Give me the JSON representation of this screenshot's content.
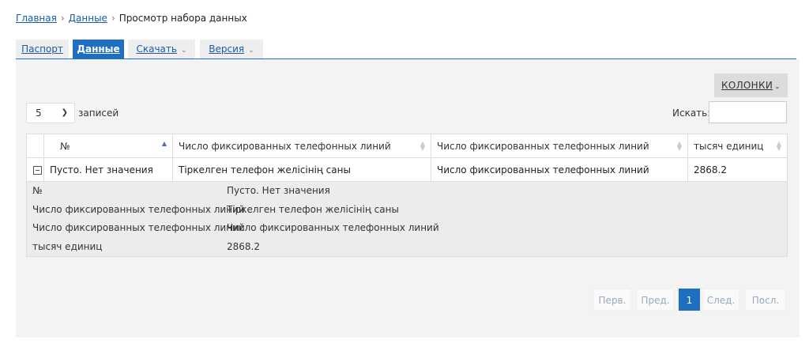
{
  "breadcrumb": {
    "home": "Главная",
    "data": "Данные",
    "current": "Просмотр набора данных",
    "separator": "›"
  },
  "tabs": {
    "passport": "Паспорт",
    "data": "Данные",
    "download": "Скачать",
    "version": "Версия",
    "caret": "⌄"
  },
  "toolbar": {
    "columns_label": "КОЛОНКИ",
    "length_value": "5",
    "length_suffix": "записей",
    "search_label": "Искать:",
    "search_value": ""
  },
  "table": {
    "headers": [
      "№",
      "Число фиксированных телефонных линий",
      "Число фиксированных телефонных линий",
      "тысяч единиц"
    ],
    "rows": [
      [
        "Пусто. Нет значения",
        "Тіркелген телефон желісінің саны",
        "Число фиксированных телефонных линий",
        "2868.2"
      ]
    ],
    "details": [
      {
        "key": "№",
        "value": "Пусто. Нет значения"
      },
      {
        "key": "Число фиксированных телефонных линий",
        "value": "Тіркелген телефон желісінің саны"
      },
      {
        "key": "Число фиксированных телефонных линий",
        "value": "Число фиксированных телефонных линий"
      },
      {
        "key": "тысяч единиц",
        "value": "2868.2"
      }
    ]
  },
  "pagination": {
    "first": "Перв.",
    "prev": "Пред.",
    "current": "1",
    "next": "След.",
    "last": "Посл."
  },
  "colors": {
    "accent": "#1f6fc1",
    "panel_bg": "#f3f3f3",
    "link": "#1a5aa6"
  }
}
